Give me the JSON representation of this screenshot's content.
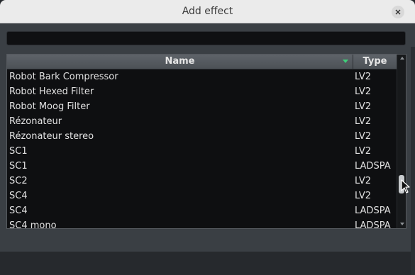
{
  "window": {
    "title": "Add effect"
  },
  "search": {
    "value": "",
    "placeholder": ""
  },
  "table": {
    "columns": [
      "Name",
      "Type"
    ],
    "rows": [
      {
        "name": "Robot Bark Compressor",
        "type": "LV2"
      },
      {
        "name": "Robot Hexed Filter",
        "type": "LV2"
      },
      {
        "name": "Robot Moog Filter",
        "type": "LV2"
      },
      {
        "name": "Rézonateur",
        "type": "LV2"
      },
      {
        "name": "Rézonateur stereo",
        "type": "LV2"
      },
      {
        "name": "SC1",
        "type": "LV2"
      },
      {
        "name": "SC1",
        "type": "LADSPA"
      },
      {
        "name": "SC2",
        "type": "LV2"
      },
      {
        "name": "SC4",
        "type": "LV2"
      },
      {
        "name": "SC4",
        "type": "LADSPA"
      },
      {
        "name": "SC4 mono",
        "type": "LADSPA"
      }
    ]
  },
  "colors": {
    "sort_indicator": "#3fcf7a",
    "table_bg": "#0e0f11",
    "header_bg": "#54595e"
  }
}
